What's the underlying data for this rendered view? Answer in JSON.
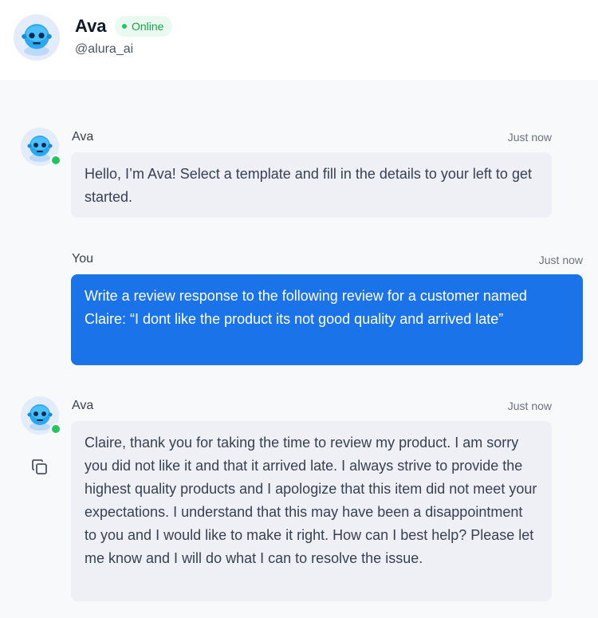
{
  "header": {
    "name": "Ava",
    "status": "Online",
    "handle": "@alura_ai",
    "avatar_icon": "robot-avatar-icon"
  },
  "messages": [
    {
      "sender": "Ava",
      "time": "Just now",
      "text": "Hello, I’m Ava! Select a template and fill in the details to your left to get started."
    },
    {
      "sender": "You",
      "time": "Just now",
      "text": "Write a review response to the following review for a customer named Claire: “I dont like the product its not good quality and arrived late”"
    },
    {
      "sender": "Ava",
      "time": "Just now",
      "text": "Claire, thank you for taking the time to review my product. I am sorry you did not like it and that it arrived late. I always strive to provide the highest quality products and I apologize that this item did not meet your expectations. I understand that this may have been a disappointment to you and I would like to make it right. How can I best help? Please let me know and I will do what I can to resolve the issue."
    }
  ],
  "colors": {
    "accent": "#1a73e8",
    "online": "#22c55e",
    "ai_bubble": "#eef0f5"
  },
  "icons": {
    "copy": "copy-icon"
  }
}
